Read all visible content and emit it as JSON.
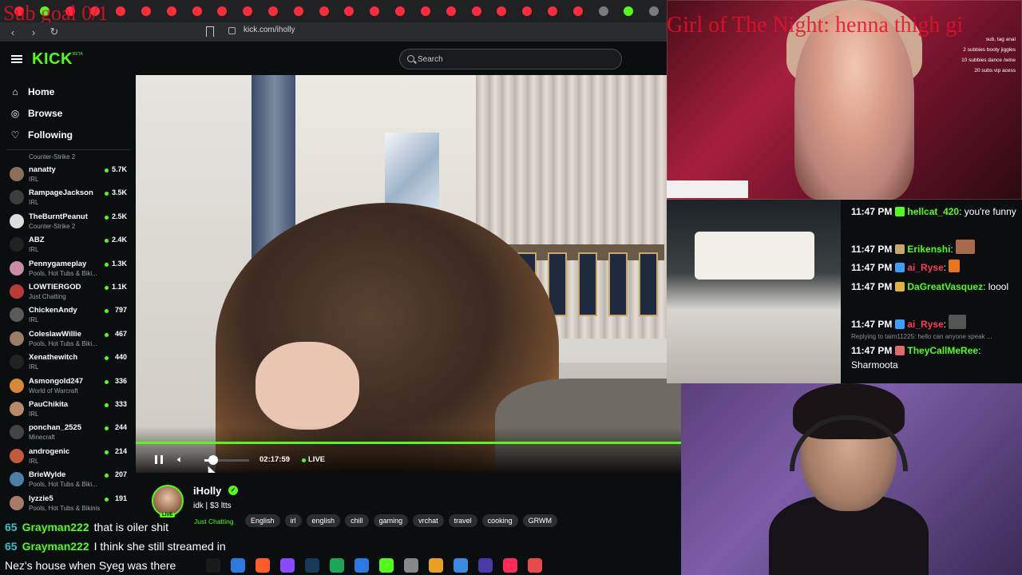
{
  "browser": {
    "url": "kick.com/iholly",
    "tab_icon_colors": [
      "#ff2a3c",
      "#53fc18",
      "#ff2a3c",
      "#ff2a3c",
      "#ff2a3c",
      "#ff2a3c",
      "#ff2a3c",
      "#ff2a3c",
      "#ff2a3c",
      "#ff2a3c",
      "#ff2a3c",
      "#ff2a3c",
      "#ff2a3c",
      "#ff2a3c",
      "#ff2a3c",
      "#ff2a3c",
      "#ff2a3c",
      "#ff2a3c",
      "#ff2a3c",
      "#ff2a3c",
      "#ff2a3c",
      "#ff2a3c",
      "#ff2a3c",
      "#7a7a7a",
      "#53fc18",
      "#7a7a7a"
    ]
  },
  "overlay": {
    "sub_goal": "Sub goal 0/1",
    "cam_goal": "Girl of The Night: henna thigh gi",
    "cam_menu": [
      "sub, tag anal",
      "2 subbies booty jiggles",
      "10 subbies dance /wine",
      "20 subs vip acess"
    ]
  },
  "header": {
    "logo": "KICK",
    "beta": "BETA",
    "search_placeholder": "Search"
  },
  "sidebar": {
    "nav": [
      {
        "label": "Home",
        "icon": "home-icon"
      },
      {
        "label": "Browse",
        "icon": "compass-icon"
      },
      {
        "label": "Following",
        "icon": "heart-icon"
      }
    ],
    "top_category": "Counter-Strike 2",
    "channels": [
      {
        "name": "nanatty",
        "category": "IRL",
        "viewers": "5.7K",
        "color": "#8a6f5a"
      },
      {
        "name": "RampageJackson",
        "category": "IRL",
        "viewers": "3.5K",
        "color": "#3d3d3d"
      },
      {
        "name": "TheBurntPeanut",
        "category": "Counter-Strike 2",
        "viewers": "2.5K",
        "color": "#ddd"
      },
      {
        "name": "ABZ",
        "category": "IRL",
        "viewers": "2.4K",
        "color": "#222"
      },
      {
        "name": "Pennygameplay",
        "category": "Pools, Hot Tubs & Biki...",
        "viewers": "1.3K",
        "color": "#c88da5"
      },
      {
        "name": "LOWTIERGOD",
        "category": "Just Chatting",
        "viewers": "1.1K",
        "color": "#b93a3a"
      },
      {
        "name": "ChickenAndy",
        "category": "IRL",
        "viewers": "797",
        "color": "#5a5a5a"
      },
      {
        "name": "ColeslawWillie",
        "category": "Pools, Hot Tubs & Biki...",
        "viewers": "467",
        "color": "#9b7c66"
      },
      {
        "name": "Xenathewitch",
        "category": "IRL",
        "viewers": "440",
        "color": "#222"
      },
      {
        "name": "Asmongold247",
        "category": "World of Warcraft",
        "viewers": "336",
        "color": "#d48a33"
      },
      {
        "name": "PauChikita",
        "category": "IRL",
        "viewers": "333",
        "color": "#b98a6a"
      },
      {
        "name": "ponchan_2525",
        "category": "Minecraft",
        "viewers": "244",
        "color": "#444"
      },
      {
        "name": "androgenic",
        "category": "IRL",
        "viewers": "214",
        "color": "#c25a3a"
      },
      {
        "name": "BrieWylde",
        "category": "Pools, Hot Tubs & Biki...",
        "viewers": "207",
        "color": "#4a7fa8"
      },
      {
        "name": "lyzzie5",
        "category": "Pools, Hot Tubs & Bikinis",
        "viewers": "191",
        "color": "#a87a6a"
      }
    ]
  },
  "player": {
    "time": "02:17:59",
    "live_label": "LIVE",
    "volume_level": 0.2
  },
  "channel": {
    "name": "iHolly",
    "live_badge": "LIVE",
    "title": "idk | $3 ltts",
    "category": "Just Chatting",
    "tags": [
      "English",
      "irl",
      "english",
      "chill",
      "gaming",
      "vrchat",
      "travel",
      "cooking",
      "GRWM"
    ]
  },
  "overlay_chat": [
    {
      "prefix": "65",
      "name": "Grayman222",
      "text": "that is oiler shit"
    },
    {
      "prefix": "65",
      "name": "Grayman222",
      "text": "I think she still streamed in"
    },
    {
      "prefix": "",
      "name": "",
      "text": "Nez's house when Syeg was there"
    }
  ],
  "chat": {
    "messages": [
      {
        "time": "11:47 PM",
        "user": "hellcat_420",
        "color": "#53fc18",
        "badge": "#53fc18",
        "text": "you're funny"
      },
      {
        "time": "11:47 PM",
        "user": "Erikenshi",
        "color": "#53fc18",
        "badge": "#c8a86a",
        "text": ""
      },
      {
        "time": "11:47 PM",
        "user": "ai_Ryse",
        "color": "#ff3a5a",
        "badge": "#3aa0ff",
        "text": ""
      },
      {
        "time": "11:47 PM",
        "user": "DaGreatVasquez",
        "color": "#53fc18",
        "badge": "#e0b040",
        "text": "loool"
      },
      {
        "time": "11:47 PM",
        "user": "ai_Ryse",
        "color": "#ff3a5a",
        "badge": "#3aa0ff",
        "text": ""
      },
      {
        "time": "11:47 PM",
        "user": "TheyCallMeRee",
        "color": "#53fc18",
        "badge": "#e06a6a",
        "text": "Sharmoota"
      }
    ],
    "reply": "Replying to taim11225: hello can anyone speak ..."
  },
  "taskbar_colors": [
    "#1a1a1a",
    "#2a7ae2",
    "#ff5a2a",
    "#8a4aff",
    "#1a3a5a",
    "#18a858",
    "#2a7ae2",
    "#53fc18",
    "#888",
    "#e8a020",
    "#3a8ae2",
    "#4a3aa8",
    "#ff2a5a",
    "#e84a4a"
  ]
}
